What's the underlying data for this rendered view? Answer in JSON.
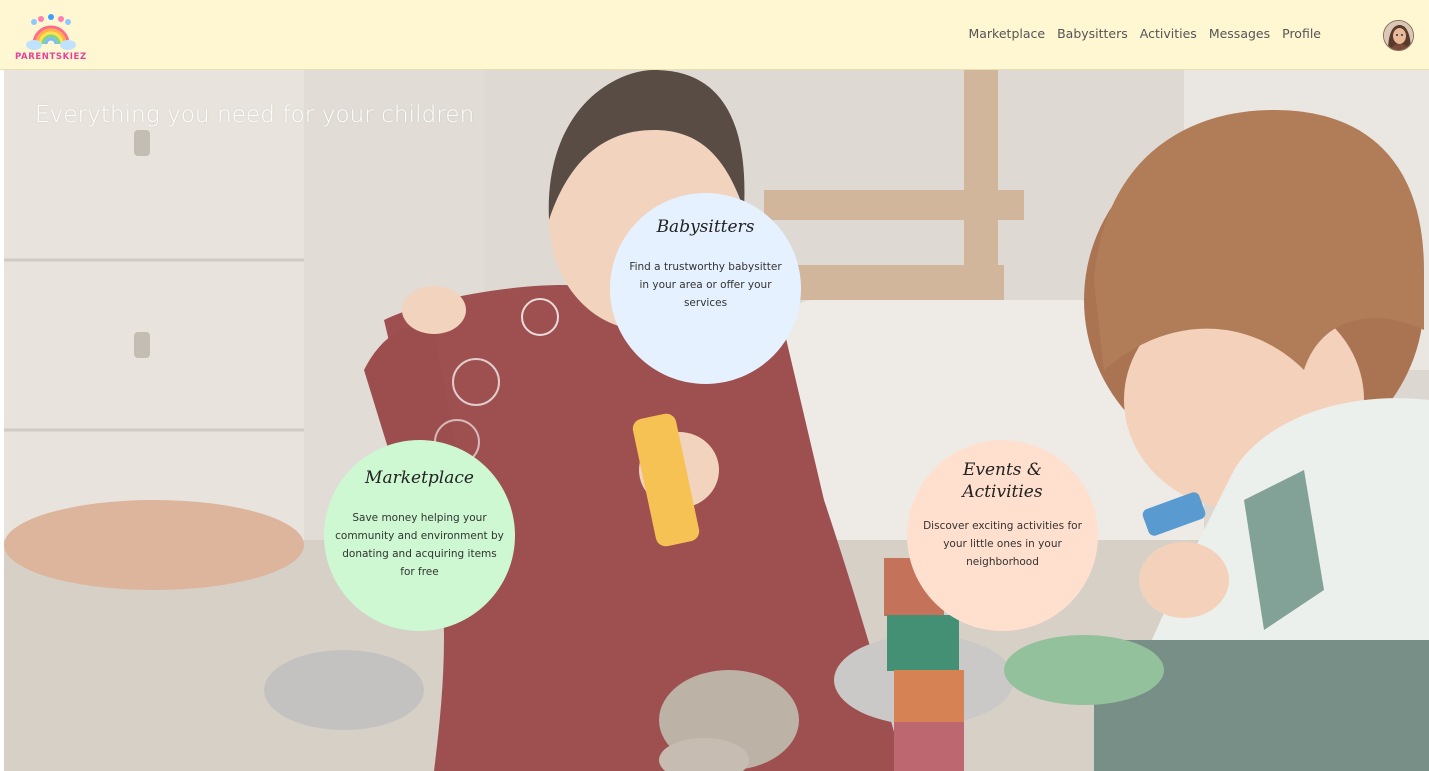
{
  "brand": {
    "name": "PARENTSKIEZ"
  },
  "nav": {
    "items": [
      "Marketplace",
      "Babysitters",
      "Activities",
      "Messages",
      "Profile"
    ]
  },
  "hero": {
    "title": "Everything you need for your children"
  },
  "cards": {
    "babysitters": {
      "title": "Babysitters",
      "description": "Find a trustworthy babysitter in your area or offer your services",
      "color": "#e6f1ff"
    },
    "marketplace": {
      "title": "Marketplace",
      "description": "Save money helping your community and environment by donating and acquiring items for free",
      "color": "#cdf8d2"
    },
    "events": {
      "title": "Events & Activities",
      "description": "Discover exciting activities for your little ones in your neighborhood",
      "color": "#ffdfce"
    }
  },
  "colors": {
    "header_bg": "#fff6d2",
    "logo_pink": "#e2449a"
  },
  "icons": {
    "logo": "rainbow-cloud-logo",
    "avatar": "user-avatar"
  }
}
